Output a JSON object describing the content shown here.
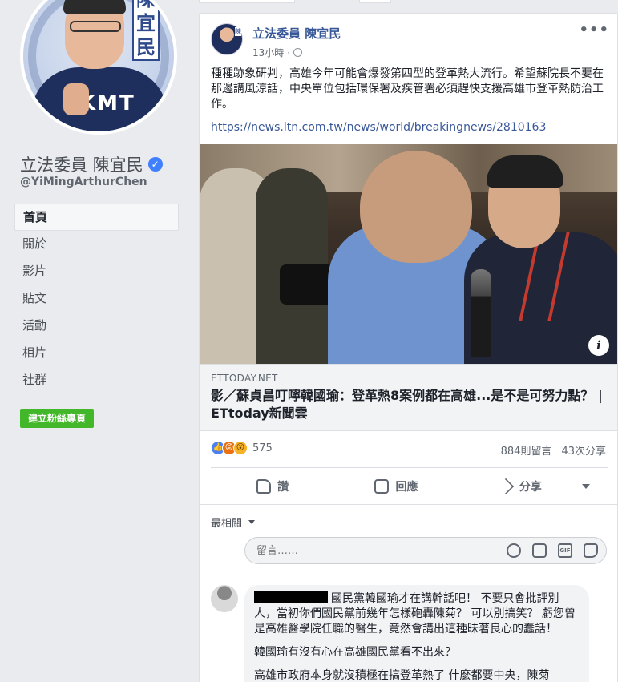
{
  "profile": {
    "name": "立法委員 陳宜民",
    "handle": "@YiMingArthurChen",
    "avatar_text": "陳宜民",
    "avatar_shirt_text": "KMT"
  },
  "nav": {
    "items": [
      {
        "label": "首頁",
        "active": true
      },
      {
        "label": "關於"
      },
      {
        "label": "影片"
      },
      {
        "label": "貼文"
      },
      {
        "label": "活動"
      },
      {
        "label": "相片"
      },
      {
        "label": "社群"
      }
    ],
    "create_button": "建立粉絲專頁"
  },
  "post": {
    "author": "立法委員 陳宜民",
    "time": "13小時",
    "time_sep": "·",
    "text": "種種跡象研判，高雄今年可能會爆發第四型的登革熱大流行。希望蘇院長不要在那邊講風涼話，中央單位包括環保署及疾管署必須趕快支援高雄市登革熱防治工作。",
    "link_url": "https://news.ltn.com.tw/news/world/breakingnews/2810163",
    "preview": {
      "domain": "ETTODAY.NET",
      "title": "影／蘇貞昌叮嚀韓國瑜：登革熱8案例都在高雄...是不是可努力點？ | ETtoday新聞雲"
    },
    "reactions_count": "575",
    "comments_count": "884則留言",
    "shares_count": "43次分享",
    "actions": {
      "like": "讚",
      "comment": "回應",
      "share": "分享"
    }
  },
  "comments": {
    "sort_label": "最相關",
    "input_placeholder": "留言……",
    "first": {
      "line1": "國民黨韓國瑜才在講幹話吧！ 不要只會批評別人，當初你們國民黨前幾年怎樣砲轟陳菊？ 可以別搞笑？ 虧您曾是高雄醫學院任職的醫生，竟然會講出這種昧著良心的蠢話！",
      "para2": "韓國瑜有沒有心在高雄國民黨看不出來？",
      "para3": "高雄市政府本身就沒積極在搞登革熱了 什麼都要中央，陳菊"
    }
  },
  "colors": {
    "link": "#385898",
    "green": "#42b72a",
    "bg": "#e9ebee"
  }
}
